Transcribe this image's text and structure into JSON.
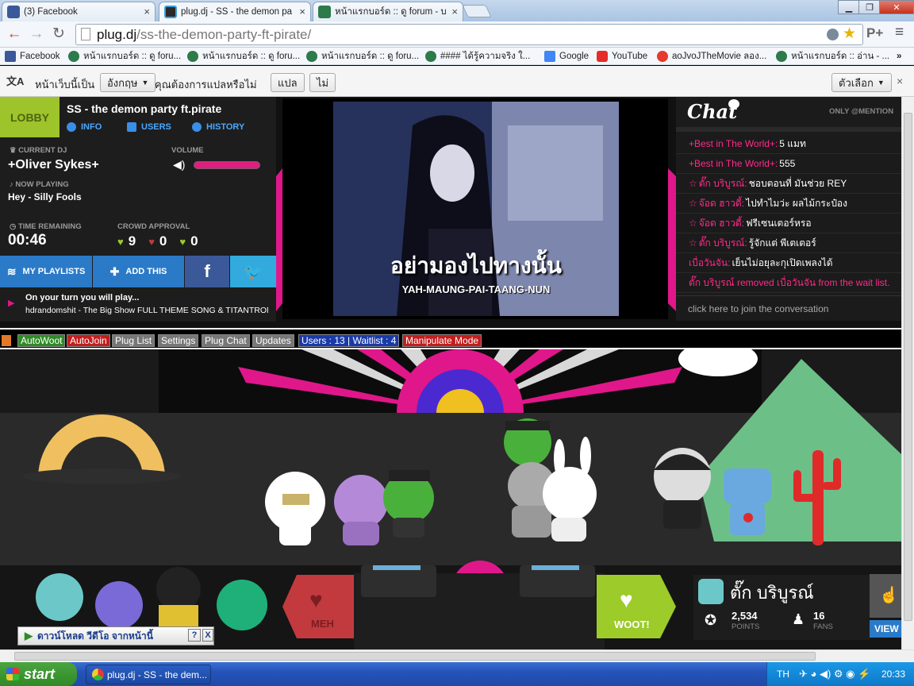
{
  "browser": {
    "tabs": [
      {
        "title": "(3) Facebook"
      },
      {
        "title": "plug.dj - SS - the demon part"
      },
      {
        "title": "หน้าแรกบอร์ด :: ดู forum - บล"
      }
    ],
    "url_domain": "plug.dj",
    "url_path": "/ss-the-demon-party-ft-pirate/",
    "bookmarks": [
      "Facebook",
      "หน้าแรกบอร์ด :: ดู foru...",
      "หน้าแรกบอร์ด :: ดู foru...",
      "หน้าแรกบอร์ด :: ดู foru...",
      "#### ได้รู้ความจริง ใ...",
      "Google",
      "YouTube",
      "aoJvoJTheMovie ลอง...",
      "หน้าแรกบอร์ด :: อ่าน - ..."
    ],
    "bookmarks_more": "»",
    "translate": {
      "prefix": "หน้าเว็บนี้เป็น",
      "language": "อังกฤษ",
      "question": "คุณต้องการแปลหรือไม่",
      "translate_btn": "แปล",
      "no_btn": "ไม่",
      "options_btn": "ตัวเลือก"
    }
  },
  "room": {
    "lobby": "LOBBY",
    "name": "SS - the demon party ft.pirate",
    "tabs": [
      "INFO",
      "USERS",
      "HISTORY"
    ]
  },
  "dj": {
    "current_dj_label": "CURRENT DJ",
    "current_dj": "+Oliver Sykes+",
    "volume_label": "VOLUME",
    "volume": 1.0,
    "now_playing_label": "NOW PLAYING",
    "now_playing": "Hey - Silly Fools",
    "time_label": "TIME REMAINING",
    "time": "00:46",
    "crowd_label": "CROWD APPROVAL",
    "woots": "9",
    "mehs": "0",
    "grabs": "0"
  },
  "playlist_buttons": {
    "my_playlists": "MY PLAYLISTS",
    "add_this": "ADD THIS"
  },
  "next": {
    "label": "On your turn you will play...",
    "track": "hdrandomshit - The Big Show FULL THEME SONG & TITANTRON"
  },
  "video": {
    "lyric_thai": "อย่ามองไปทางนั้น",
    "lyric_roman": "YAH-MAUNG-PAI-TAANG-NUN"
  },
  "chat": {
    "title": "Chat",
    "only_mentions": "ONLY @MENTION",
    "messages": [
      {
        "user": "+Best in The World+:",
        "text": " 5 แมท"
      },
      {
        "user": "+Best in The World+:",
        "text": " 555"
      },
      {
        "user": "ตั๊ก บริบูรณ์:",
        "text": " ชอบตอนที่ มันช่วย REY"
      },
      {
        "user": "จ๊อด ฮาวดี้:",
        "text": " ไปทำไมว่ะ ผลไม้กระป๋อง"
      },
      {
        "user": "จ๊อด ฮาวดี้:",
        "text": " ฟรีเซนเตอร์หรอ"
      },
      {
        "user": "ตั๊ก บริบูรณ์:",
        "text": " รู้จักแต่ พีเตเตอร์"
      },
      {
        "user": "เบื่อวันจัน:",
        "text": " เย็นไม่อยุละกุเปิดเพลงได้"
      },
      {
        "user": "ตั๊ก บริบูรณ์ removed เบื่อวันจัน from the wait list.",
        "text": ""
      }
    ],
    "join": "click here to join the conversation"
  },
  "extension": {
    "autowoot": "AutoWoot",
    "autojoin": "AutoJoin",
    "pluglist": "Plug List",
    "settings": "Settings",
    "plugchat": "Plug Chat",
    "updates": "Updates",
    "users": "Users : 13 | Waitlist : 4",
    "manipulate": "Manipulate Mode"
  },
  "controls": {
    "meh": "MEH",
    "woot": "WOOT!"
  },
  "user": {
    "name": "ตั๊ก บริบูรณ์",
    "points": "2,534",
    "points_label": "POINTS",
    "fans": "16",
    "fans_label": "FANS",
    "view": "VIEW"
  },
  "download_bar": {
    "label": "ดาวน์โหลด วีดีโอ จากหน้านี้",
    "help": "?",
    "close": "X"
  },
  "taskbar": {
    "start": "start",
    "item": "plug.dj - SS - the dem...",
    "lang": "TH",
    "clock": "20:33"
  },
  "colors": {
    "lobby": "#9dc42a",
    "pink": "#e01e80",
    "woot": "#9ccb2a",
    "meh": "#c23a3e"
  }
}
